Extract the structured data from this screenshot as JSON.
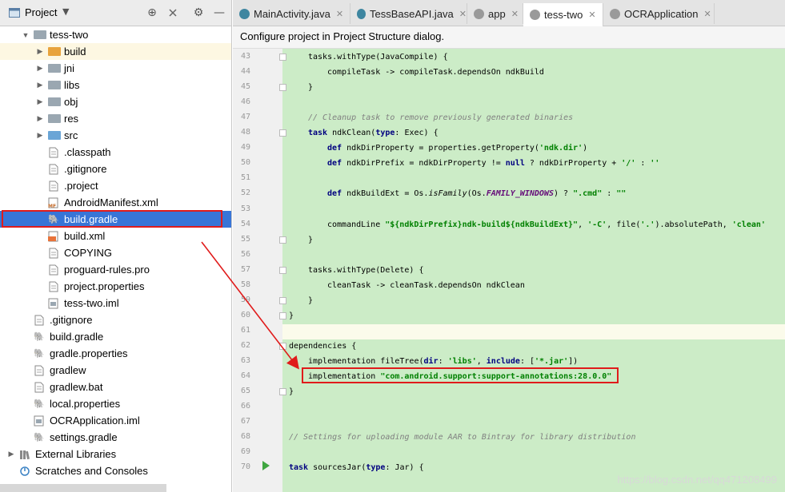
{
  "project_panel": {
    "title": "Project",
    "tree": [
      {
        "label": "tess-two",
        "depth": 1,
        "icon": "module-folder-icon",
        "expanded": true
      },
      {
        "label": "build",
        "depth": 2,
        "icon": "folder-icon",
        "kind": "orange",
        "expandable": true,
        "highlight": true
      },
      {
        "label": "jni",
        "depth": 2,
        "icon": "folder-icon",
        "expandable": true
      },
      {
        "label": "libs",
        "depth": 2,
        "icon": "folder-icon",
        "expandable": true
      },
      {
        "label": "obj",
        "depth": 2,
        "icon": "folder-icon",
        "expandable": true
      },
      {
        "label": "res",
        "depth": 2,
        "icon": "folder-icon",
        "expandable": true
      },
      {
        "label": "src",
        "depth": 2,
        "icon": "folder-icon",
        "kind": "blue",
        "expandable": true
      },
      {
        "label": ".classpath",
        "depth": 2,
        "icon": "file-icon"
      },
      {
        "label": ".gitignore",
        "depth": 2,
        "icon": "file-icon"
      },
      {
        "label": ".project",
        "depth": 2,
        "icon": "file-icon"
      },
      {
        "label": "AndroidManifest.xml",
        "depth": 2,
        "icon": "manifest-icon"
      },
      {
        "label": "build.gradle",
        "depth": 2,
        "icon": "gradle-icon",
        "selected": true
      },
      {
        "label": "build.xml",
        "depth": 2,
        "icon": "xml-file-icon"
      },
      {
        "label": "COPYING",
        "depth": 2,
        "icon": "file-icon"
      },
      {
        "label": "proguard-rules.pro",
        "depth": 2,
        "icon": "file-icon"
      },
      {
        "label": "project.properties",
        "depth": 2,
        "icon": "file-icon"
      },
      {
        "label": "tess-two.iml",
        "depth": 2,
        "icon": "iml-file-icon"
      },
      {
        "label": ".gitignore",
        "depth": 1,
        "icon": "file-icon"
      },
      {
        "label": "build.gradle",
        "depth": 1,
        "icon": "gradle-icon"
      },
      {
        "label": "gradle.properties",
        "depth": 1,
        "icon": "gradle-icon"
      },
      {
        "label": "gradlew",
        "depth": 1,
        "icon": "file-icon"
      },
      {
        "label": "gradlew.bat",
        "depth": 1,
        "icon": "file-icon"
      },
      {
        "label": "local.properties",
        "depth": 1,
        "icon": "gradle-icon"
      },
      {
        "label": "OCRApplication.iml",
        "depth": 1,
        "icon": "iml-file-icon"
      },
      {
        "label": "settings.gradle",
        "depth": 1,
        "icon": "gradle-icon"
      },
      {
        "label": "External Libraries",
        "depth": 0,
        "icon": "library-icon",
        "expandable": true
      },
      {
        "label": "Scratches and Consoles",
        "depth": 0,
        "icon": "scratches-icon"
      }
    ]
  },
  "tabs": [
    {
      "label": "MainActivity.java",
      "icon": "java-class-icon",
      "color": "#3e86a0"
    },
    {
      "label": "TessBaseAPI.java",
      "icon": "java-class-icon",
      "color": "#3e86a0"
    },
    {
      "label": "app",
      "icon": "gradle-icon",
      "color": "#9a9a9a"
    },
    {
      "label": "tess-two",
      "icon": "gradle-icon",
      "color": "#9a9a9a",
      "active": true
    },
    {
      "label": "OCRApplication",
      "icon": "gradle-icon",
      "color": "#9a9a9a"
    }
  ],
  "notification": "Configure project in Project Structure dialog.",
  "editor": {
    "lines": [
      {
        "n": "43",
        "code": "tasks.withType(JavaCompile) {"
      },
      {
        "n": "44",
        "code": "compileTask -> compileTask.dependsOn ndkBuild"
      },
      {
        "n": "45",
        "code": "}"
      },
      {
        "n": "46",
        "code": ""
      },
      {
        "n": "47",
        "code": "// Cleanup task to remove previously generated binaries"
      },
      {
        "n": "48",
        "code": "task ndkClean(type: Exec) {"
      },
      {
        "n": "49",
        "code": "def ndkDirProperty = properties.getProperty('ndk.dir')"
      },
      {
        "n": "50",
        "code": "def ndkDirPrefix = ndkDirProperty != null ? ndkDirProperty + '/' : ''"
      },
      {
        "n": "51",
        "code": ""
      },
      {
        "n": "52",
        "code": "def ndkBuildExt = Os.isFamily(Os.FAMILY_WINDOWS) ? \".cmd\" : \"\""
      },
      {
        "n": "53",
        "code": ""
      },
      {
        "n": "54",
        "code": "commandLine \"${ndkDirPrefix}ndk-build${ndkBuildExt}\", '-C', file('.').absolutePath, 'clean'"
      },
      {
        "n": "55",
        "code": "}"
      },
      {
        "n": "56",
        "code": ""
      },
      {
        "n": "57",
        "code": "tasks.withType(Delete) {"
      },
      {
        "n": "58",
        "code": "cleanTask -> cleanTask.dependsOn ndkClean"
      },
      {
        "n": "59",
        "code": "}"
      },
      {
        "n": "60",
        "code": "}"
      },
      {
        "n": "61",
        "code": ""
      },
      {
        "n": "62",
        "code": "dependencies {"
      },
      {
        "n": "63",
        "code": "implementation fileTree(dir: 'libs', include: ['*.jar'])"
      },
      {
        "n": "64",
        "code": "implementation \"com.android.support:support-annotations:28.0.0\""
      },
      {
        "n": "65",
        "code": "}"
      },
      {
        "n": "66",
        "code": ""
      },
      {
        "n": "67",
        "code": ""
      },
      {
        "n": "68",
        "code": "// Settings for uploading module AAR to Bintray for library distribution"
      },
      {
        "n": "69",
        "code": ""
      },
      {
        "n": "70",
        "code": "task sourcesJar(type: Jar) {"
      }
    ]
  },
  "watermark": "https://blog.csdn.net/qq471208499",
  "colors": {
    "selection": "#3875d7",
    "annotation_red": "#e01b1b",
    "editor_bg": "#ccecc7",
    "keyword": "#000080",
    "string": "#008000",
    "comment": "#808080"
  }
}
